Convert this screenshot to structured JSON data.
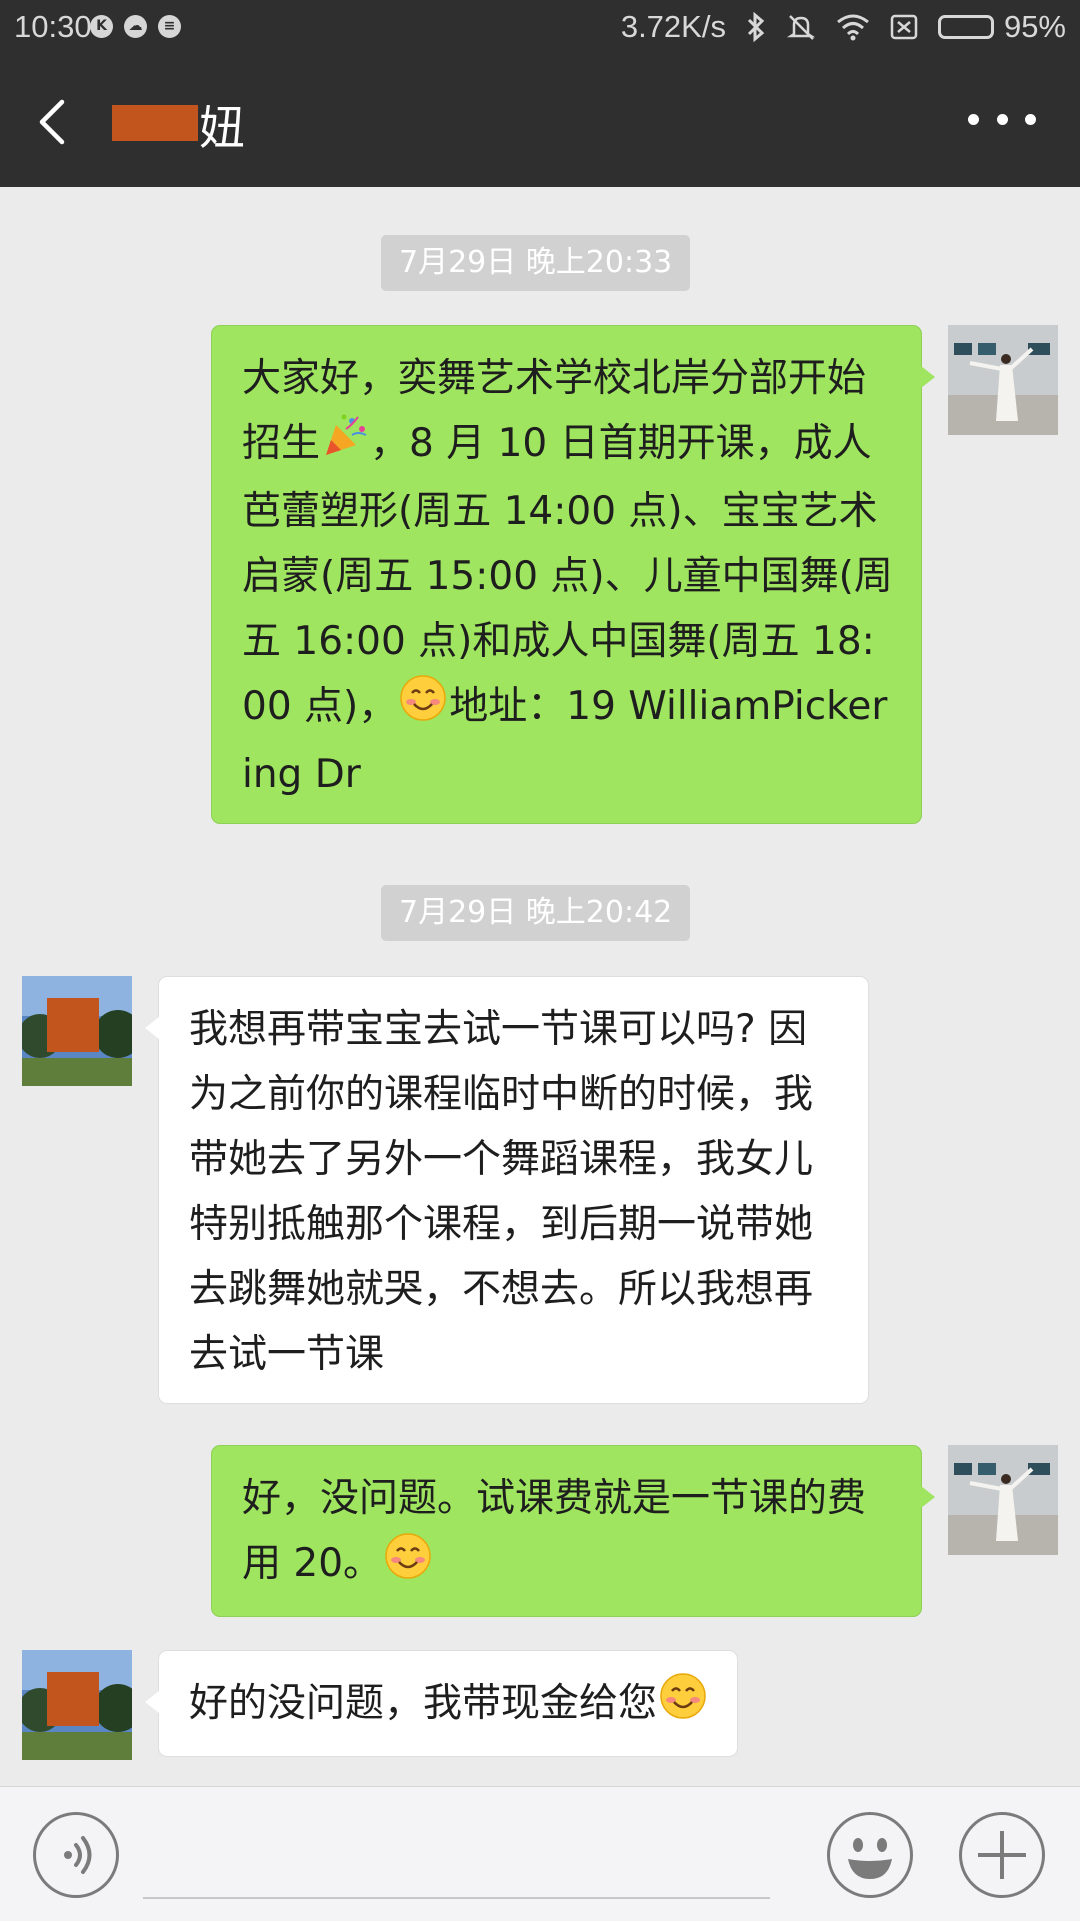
{
  "status_bar": {
    "time": "10:30",
    "net_speed": "3.72K/s",
    "battery_percent": "95%",
    "battery_level": 0.95
  },
  "header": {
    "title_visible": "妞"
  },
  "messages": {
    "ts1": "7月29日 晚上20:33",
    "m1_p1": "大家好，奕舞艺术学校北岸分部开始招生",
    "m1_p2": "，8 月 10 日首期开课，成人芭蕾塑形(周五 14:00 点)、宝宝艺术启蒙(周五 15:00 点)、儿童中国舞(周五 16:00 点)和成人中国舞(周五 18:00 点)，",
    "m1_p3": "地址：19 WilliamPickering Dr",
    "ts2": "7月29日 晚上20:42",
    "m2": "我想再带宝宝去试一节课可以吗? 因为之前你的课程临时中断的时候，我带她去了另外一个舞蹈课程，我女儿特别抵触那个课程，到后期一说带她去跳舞她就哭，不想去。所以我想再去试一节课",
    "m3_p1": "好，没问题。试课费就是一节课的费用 20。",
    "m4_p1": "好的没问题，我带现金给您"
  },
  "input": {
    "placeholder": ""
  },
  "colors": {
    "header_bg": "#2f2f2f",
    "chat_bg": "#ebebeb",
    "outgoing_bubble": "#9fe55f",
    "incoming_bubble": "#ffffff",
    "redaction": "#c2541d"
  },
  "icons": [
    "back-arrow-icon",
    "more-icon",
    "voice-icon",
    "emoji-icon",
    "plus-icon",
    "party-popper-emoji",
    "smile-emoji"
  ]
}
